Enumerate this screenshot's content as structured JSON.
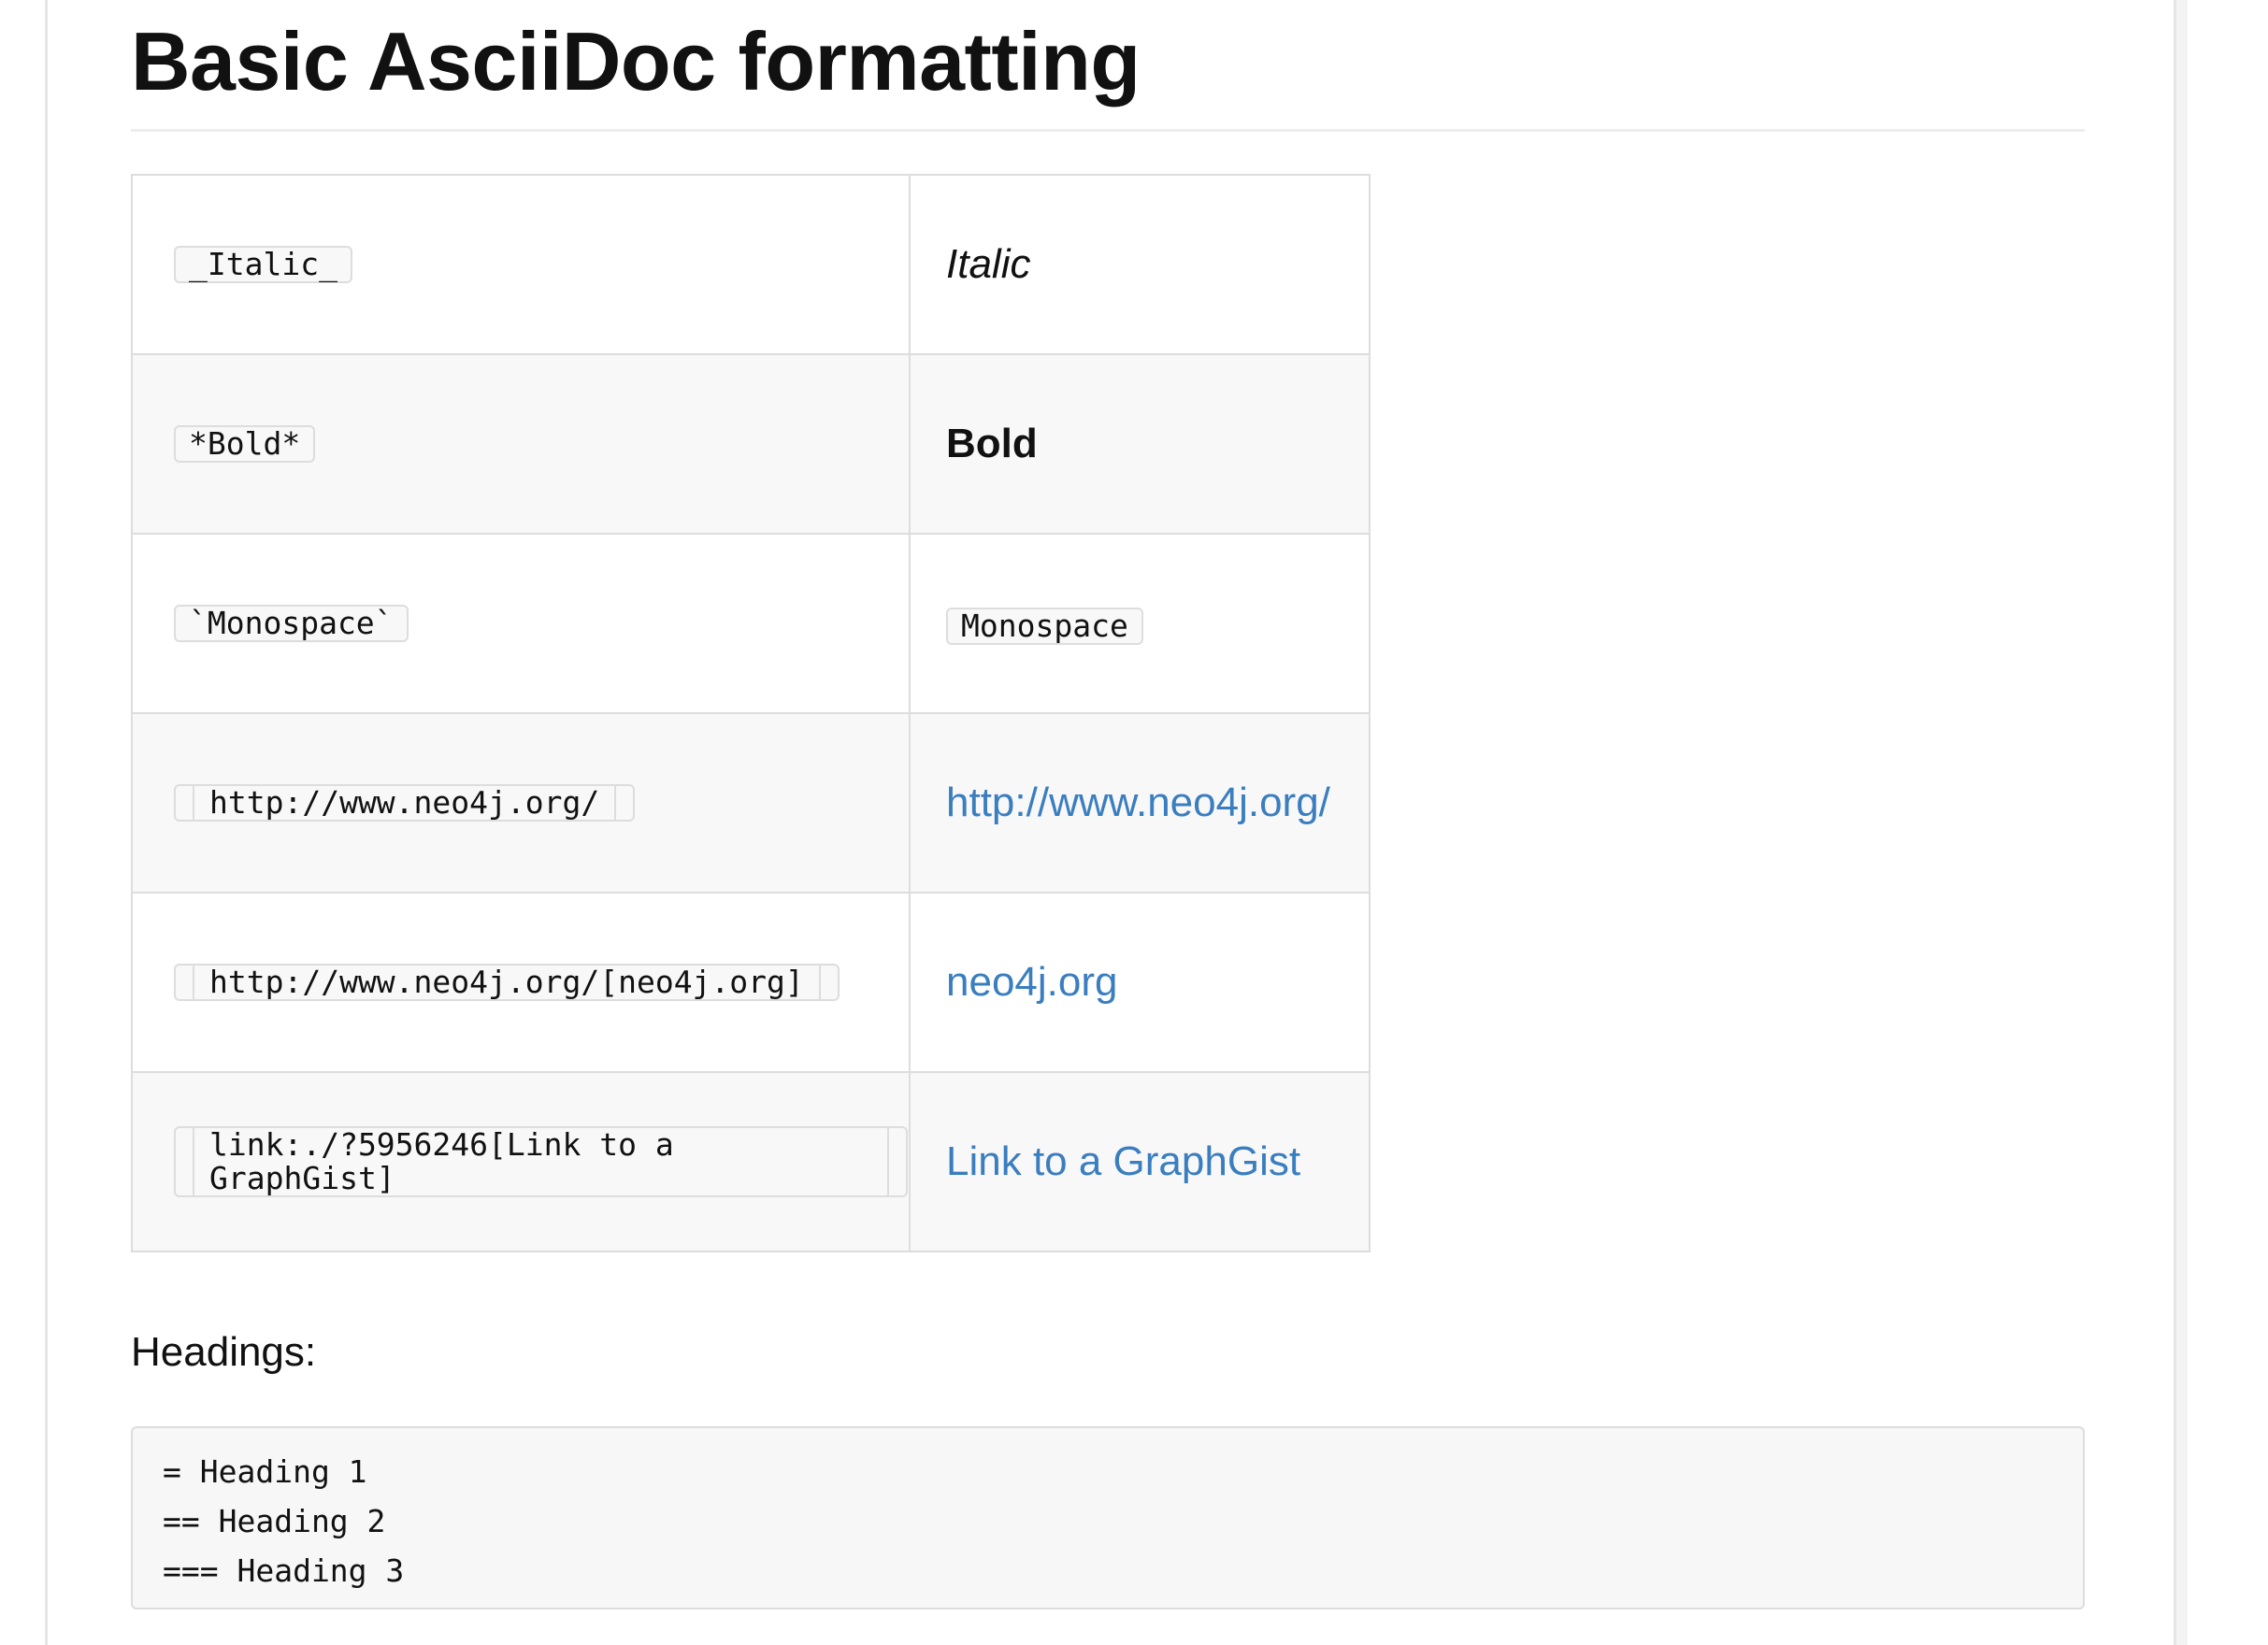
{
  "document": {
    "title": "Basic AsciiDoc formatting"
  },
  "format_table": {
    "rows": [
      {
        "source": "_Italic_",
        "result": "Italic"
      },
      {
        "source": "*Bold*",
        "result": "Bold"
      },
      {
        "source": "`Monospace`",
        "result": "Monospace"
      },
      {
        "source": "http://www.neo4j.org/",
        "result": "http://www.neo4j.org/"
      },
      {
        "source": "http://www.neo4j.org/[neo4j.org]",
        "result": "neo4j.org"
      },
      {
        "source": "link:./?5956246[Link to a GraphGist]",
        "result": "Link to a GraphGist"
      }
    ]
  },
  "headings_section": {
    "label": "Headings:",
    "code_lines": [
      "= Heading 1",
      "== Heading 2",
      "=== Heading 3"
    ]
  },
  "colors": {
    "link": "#3a7ec0",
    "border": "#dddddd",
    "striped_row": "#f8f8f8"
  }
}
